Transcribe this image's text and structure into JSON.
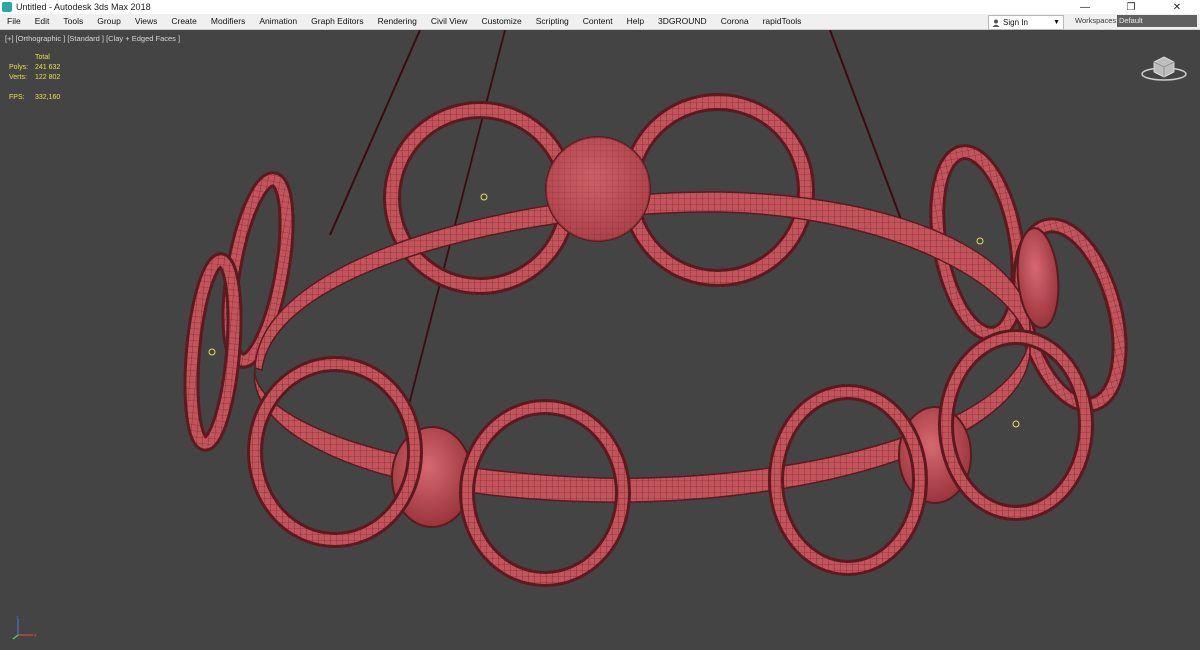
{
  "window": {
    "title": "Untitled - Autodesk 3ds Max 2018",
    "controls": [
      "—",
      "❐",
      "✕"
    ]
  },
  "menu": [
    "File",
    "Edit",
    "Tools",
    "Group",
    "Views",
    "Create",
    "Modifiers",
    "Animation",
    "Graph Editors",
    "Rendering",
    "Civil View",
    "Customize",
    "Scripting",
    "Content",
    "Help",
    "3DGROUND",
    "Corona",
    "rapidTools"
  ],
  "signin": {
    "label": "Sign In"
  },
  "workspace": {
    "label": "Workspaces:",
    "value": "Default"
  },
  "viewport": {
    "label": "[+] [Orthographic ] [Standard ] [Clay + Edged Faces ]",
    "stats": {
      "header": "Total",
      "polys_label": "Polys:",
      "polys": "241 632",
      "verts_label": "Verts:",
      "verts": "122 802",
      "fps_label": "FPS:",
      "fps": "332,160"
    }
  },
  "colors": {
    "mesh_fill": "#c4545c",
    "mesh_dark": "#5a1a1e",
    "wire": "#3a0c10",
    "background": "#444444",
    "stats_text": "#e8e04a"
  }
}
